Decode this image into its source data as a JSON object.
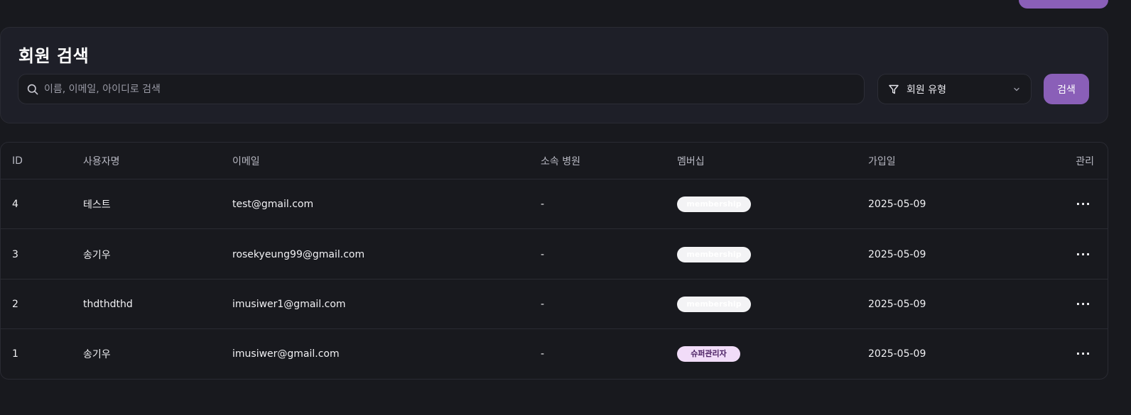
{
  "search": {
    "title": "회원 검색",
    "placeholder": "이름, 이메일, 아이디로 검색",
    "type_label": "회원 유형",
    "button_label": "검색"
  },
  "table": {
    "headers": {
      "id": "ID",
      "name": "사용자명",
      "email": "이메일",
      "hospital": "소속 병원",
      "membership": "멤버십",
      "joined": "가입일",
      "manage": "관리"
    },
    "rows": [
      {
        "id": "4",
        "name": "테스트",
        "email": "test@gmail.com",
        "hospital": "-",
        "membership": "membership",
        "joined": "2025-05-09"
      },
      {
        "id": "3",
        "name": "송기우",
        "email": "rosekyeung99@gmail.com",
        "hospital": "-",
        "membership": "membership",
        "joined": "2025-05-09"
      },
      {
        "id": "2",
        "name": "thdthdthd",
        "email": "imusiwer1@gmail.com",
        "hospital": "-",
        "membership": "membership",
        "joined": "2025-05-09"
      },
      {
        "id": "1",
        "name": "송기우",
        "email": "imusiwer@gmail.com",
        "hospital": "-",
        "membership": "슈퍼관리자",
        "joined": "2025-05-09"
      }
    ],
    "more_icon": "more-horizontal-icon"
  },
  "colors": {
    "accent": "#8a5fb8",
    "background": "#18191e",
    "card": "#1e1f28",
    "admin_badge": "#f1dcf8"
  }
}
